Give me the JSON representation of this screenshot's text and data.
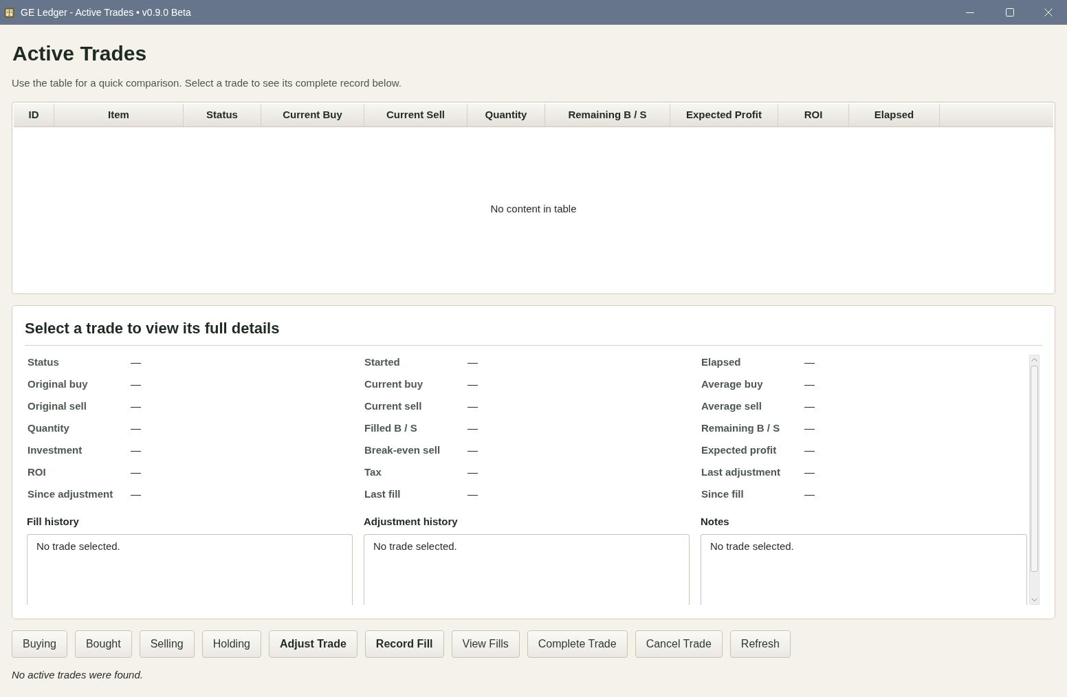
{
  "window": {
    "title": "GE Ledger - Active Trades • v0.9.0 Beta"
  },
  "page": {
    "title": "Active Trades",
    "subtitle": "Use the table for a quick comparison. Select a trade to see its complete record below."
  },
  "table": {
    "columns": [
      "ID",
      "Item",
      "Status",
      "Current Buy",
      "Current Sell",
      "Quantity",
      "Remaining B / S",
      "Expected Profit",
      "ROI",
      "Elapsed"
    ],
    "empty_message": "No content in table"
  },
  "details": {
    "title": "Select a trade to view its full details",
    "field_columns": [
      [
        {
          "label": "Status",
          "value": "—"
        },
        {
          "label": "Original buy",
          "value": "—"
        },
        {
          "label": "Original sell",
          "value": "—"
        },
        {
          "label": "Quantity",
          "value": "—"
        },
        {
          "label": "Investment",
          "value": "—"
        },
        {
          "label": "ROI",
          "value": "—"
        },
        {
          "label": "Since adjustment",
          "value": "—"
        }
      ],
      [
        {
          "label": "Started",
          "value": "—"
        },
        {
          "label": "Current buy",
          "value": "—"
        },
        {
          "label": "Current sell",
          "value": "—"
        },
        {
          "label": "Filled B / S",
          "value": "—"
        },
        {
          "label": "Break-even sell",
          "value": "—"
        },
        {
          "label": "Tax",
          "value": "—"
        },
        {
          "label": "Last fill",
          "value": "—"
        }
      ],
      [
        {
          "label": "Elapsed",
          "value": "—"
        },
        {
          "label": "Average buy",
          "value": "—"
        },
        {
          "label": "Average sell",
          "value": "—"
        },
        {
          "label": "Remaining B / S",
          "value": "—"
        },
        {
          "label": "Expected profit",
          "value": "—"
        },
        {
          "label": "Last adjustment",
          "value": "—"
        },
        {
          "label": "Since fill",
          "value": "—"
        }
      ]
    ],
    "sections": [
      {
        "title": "Fill history",
        "value": "No trade selected."
      },
      {
        "title": "Adjustment history",
        "value": "No trade selected."
      },
      {
        "title": "Notes",
        "value": "No trade selected."
      }
    ]
  },
  "buttons": [
    {
      "label": "Buying",
      "emphasized": false
    },
    {
      "label": "Bought",
      "emphasized": false
    },
    {
      "label": "Selling",
      "emphasized": false
    },
    {
      "label": "Holding",
      "emphasized": false
    },
    {
      "label": "Adjust Trade",
      "emphasized": true
    },
    {
      "label": "Record Fill",
      "emphasized": true
    },
    {
      "label": "View Fills",
      "emphasized": false
    },
    {
      "label": "Complete Trade",
      "emphasized": false
    },
    {
      "label": "Cancel Trade",
      "emphasized": false
    },
    {
      "label": "Refresh",
      "emphasized": false
    }
  ],
  "status_message": "No active trades were found."
}
